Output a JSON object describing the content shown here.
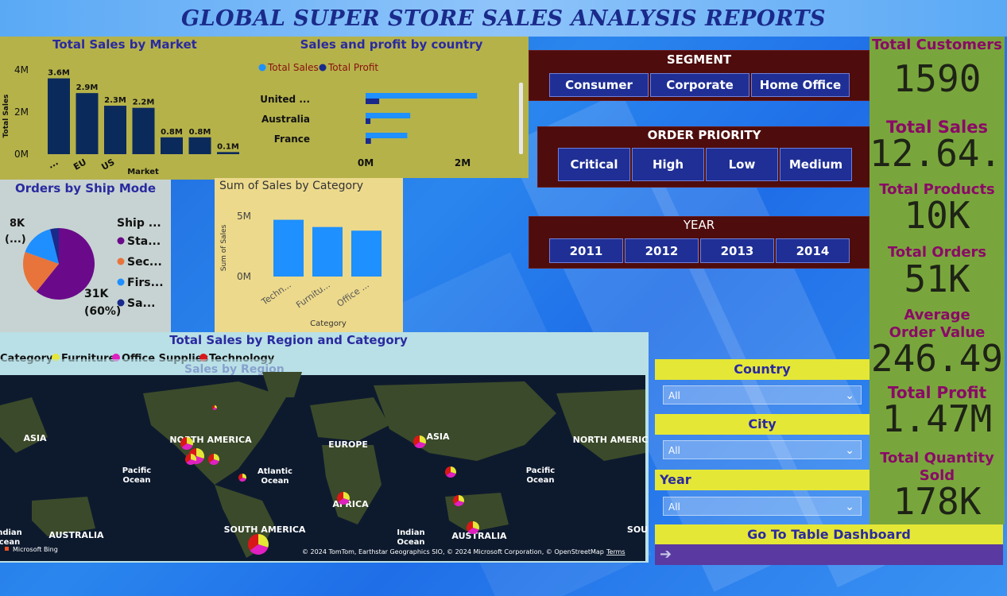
{
  "header": {
    "title": "GLOBAL SUPER STORE SALES ANALYSIS REPORTS"
  },
  "market_chart": {
    "title": "Total Sales by Market",
    "ylabel": "Total Sales",
    "xlabel": "Market",
    "y_ticks": [
      "0M",
      "2M",
      "4M"
    ],
    "categories": [
      "...",
      "EU",
      "US",
      "",
      "",
      "",
      ""
    ],
    "labels": [
      "3.6M",
      "2.9M",
      "2.3M",
      "2.2M",
      "0.8M",
      "0.8M",
      "0.1M"
    ]
  },
  "country_chart": {
    "title": "Sales and profit by country",
    "legend": [
      "Total Sales",
      "Total Profit"
    ],
    "countries": [
      "United ...",
      "Australia",
      "France"
    ],
    "x_ticks": [
      "0M",
      "2M"
    ]
  },
  "shipmode_chart": {
    "title": "Orders by Ship Mode",
    "legend_title": "Ship ...",
    "legend": [
      "Sta...",
      "Sec...",
      "Firs...",
      "Sa..."
    ],
    "label_big": "31K",
    "label_big_pct": "(60%)",
    "label_small": "8K",
    "label_small_pct": "(...)"
  },
  "category_chart": {
    "title": "Sum of Sales by Category",
    "ylabel": "Sum of Sales",
    "xlabel": "Category",
    "y_ticks": [
      "0M",
      "5M"
    ],
    "categories": [
      "Techn...",
      "Furnitu...",
      "Office ..."
    ]
  },
  "map": {
    "title": "Total Sales by Region and Category",
    "legend_title": "Category",
    "legend": [
      "Furniture",
      "Office Supplies",
      "Technology"
    ],
    "ghost_title": "Sales by Region",
    "labels": {
      "asia_left": "ASIA",
      "north_america": "NORTH AMERICA",
      "europe": "EUROPE",
      "asia": "ASIA",
      "north_america_right": "NORTH AMERIC",
      "pacific_left": "Pacific\nOcean",
      "atlantic": "Atlantic\nOcean",
      "pacific_right": "Pacific\nOcean",
      "africa": "AFRICA",
      "indian": "Indian\nOcean",
      "australia_left": "AUSTRALIA",
      "south_america": "SOUTH AMERICA",
      "australia": "AUSTRALIA",
      "indian_left": "ndian\ncean",
      "sou": "SOU"
    },
    "brand": "Microsoft Bing",
    "copyright": "© 2024 TomTom, Earthstar Geographics SIO, © 2024 Microsoft Corporation, © OpenStreetMap",
    "terms": "Terms"
  },
  "segment": {
    "title": "SEGMENT",
    "options": [
      "Consumer",
      "Corporate",
      "Home Office"
    ]
  },
  "priority": {
    "title": "ORDER PRIORITY",
    "options": [
      "Critical",
      "High",
      "Low",
      "Medium"
    ]
  },
  "year": {
    "title": "YEAR",
    "options": [
      "2011",
      "2012",
      "2013",
      "2014"
    ]
  },
  "filters": {
    "country": {
      "label": "Country",
      "value": "All"
    },
    "city": {
      "label": "City",
      "value": "All"
    },
    "year": {
      "label": "Year",
      "value": "All"
    }
  },
  "nav": {
    "table_dashboard": "Go To Table Dashboard",
    "arrow": "➔"
  },
  "kpis": {
    "customers": {
      "label": "Total Customers",
      "value": "1590"
    },
    "sales": {
      "label": "Total Sales",
      "value": "12.64..."
    },
    "products": {
      "label": "Total Products",
      "value": "10K"
    },
    "orders": {
      "label": "Total Orders",
      "value": "51K"
    },
    "aov": {
      "label": "Average Order Value",
      "value": "246.49"
    },
    "profit": {
      "label": "Total Profit",
      "value": "1.47M"
    },
    "quantity": {
      "label": "Total Quantity Sold",
      "value": "178K"
    }
  },
  "colors": {
    "market_bar": "#0b2a5c",
    "sales_bar": "#1e90ff",
    "profit_bar": "#1a2a8a",
    "pie": [
      "#6a0a8a",
      "#e8743b",
      "#1f8fff",
      "#1a2a8a"
    ],
    "furniture": "#e5e736",
    "office": "#e020c0",
    "technology": "#d81818"
  },
  "chart_data": [
    {
      "type": "bar",
      "title": "Total Sales by Market",
      "xlabel": "Market",
      "ylabel": "Total Sales",
      "categories": [
        "...",
        "EU",
        "US",
        "",
        "",
        "",
        ""
      ],
      "values": [
        3.6,
        2.9,
        2.3,
        2.2,
        0.8,
        0.8,
        0.1
      ],
      "ylim": [
        0,
        4
      ]
    },
    {
      "type": "bar",
      "title": "Sales and profit by country",
      "categories": [
        "United ...",
        "Australia",
        "France"
      ],
      "series": [
        {
          "name": "Total Sales",
          "values": [
            2.3,
            0.92,
            0.86
          ]
        },
        {
          "name": "Total Profit",
          "values": [
            0.28,
            0.1,
            0.11
          ]
        }
      ],
      "xlim": [
        0,
        2.5
      ]
    },
    {
      "type": "pie",
      "title": "Orders by Ship Mode",
      "categories": [
        "Sta...",
        "Sec...",
        "Firs...",
        "Sa..."
      ],
      "values": [
        31,
        10,
        8,
        2
      ]
    },
    {
      "type": "bar",
      "title": "Sum of Sales by Category",
      "xlabel": "Category",
      "ylabel": "Sum of Sales",
      "categories": [
        "Techn...",
        "Furnitu...",
        "Office ..."
      ],
      "values": [
        4.7,
        4.1,
        3.8
      ],
      "ylim": [
        0,
        6
      ]
    }
  ]
}
